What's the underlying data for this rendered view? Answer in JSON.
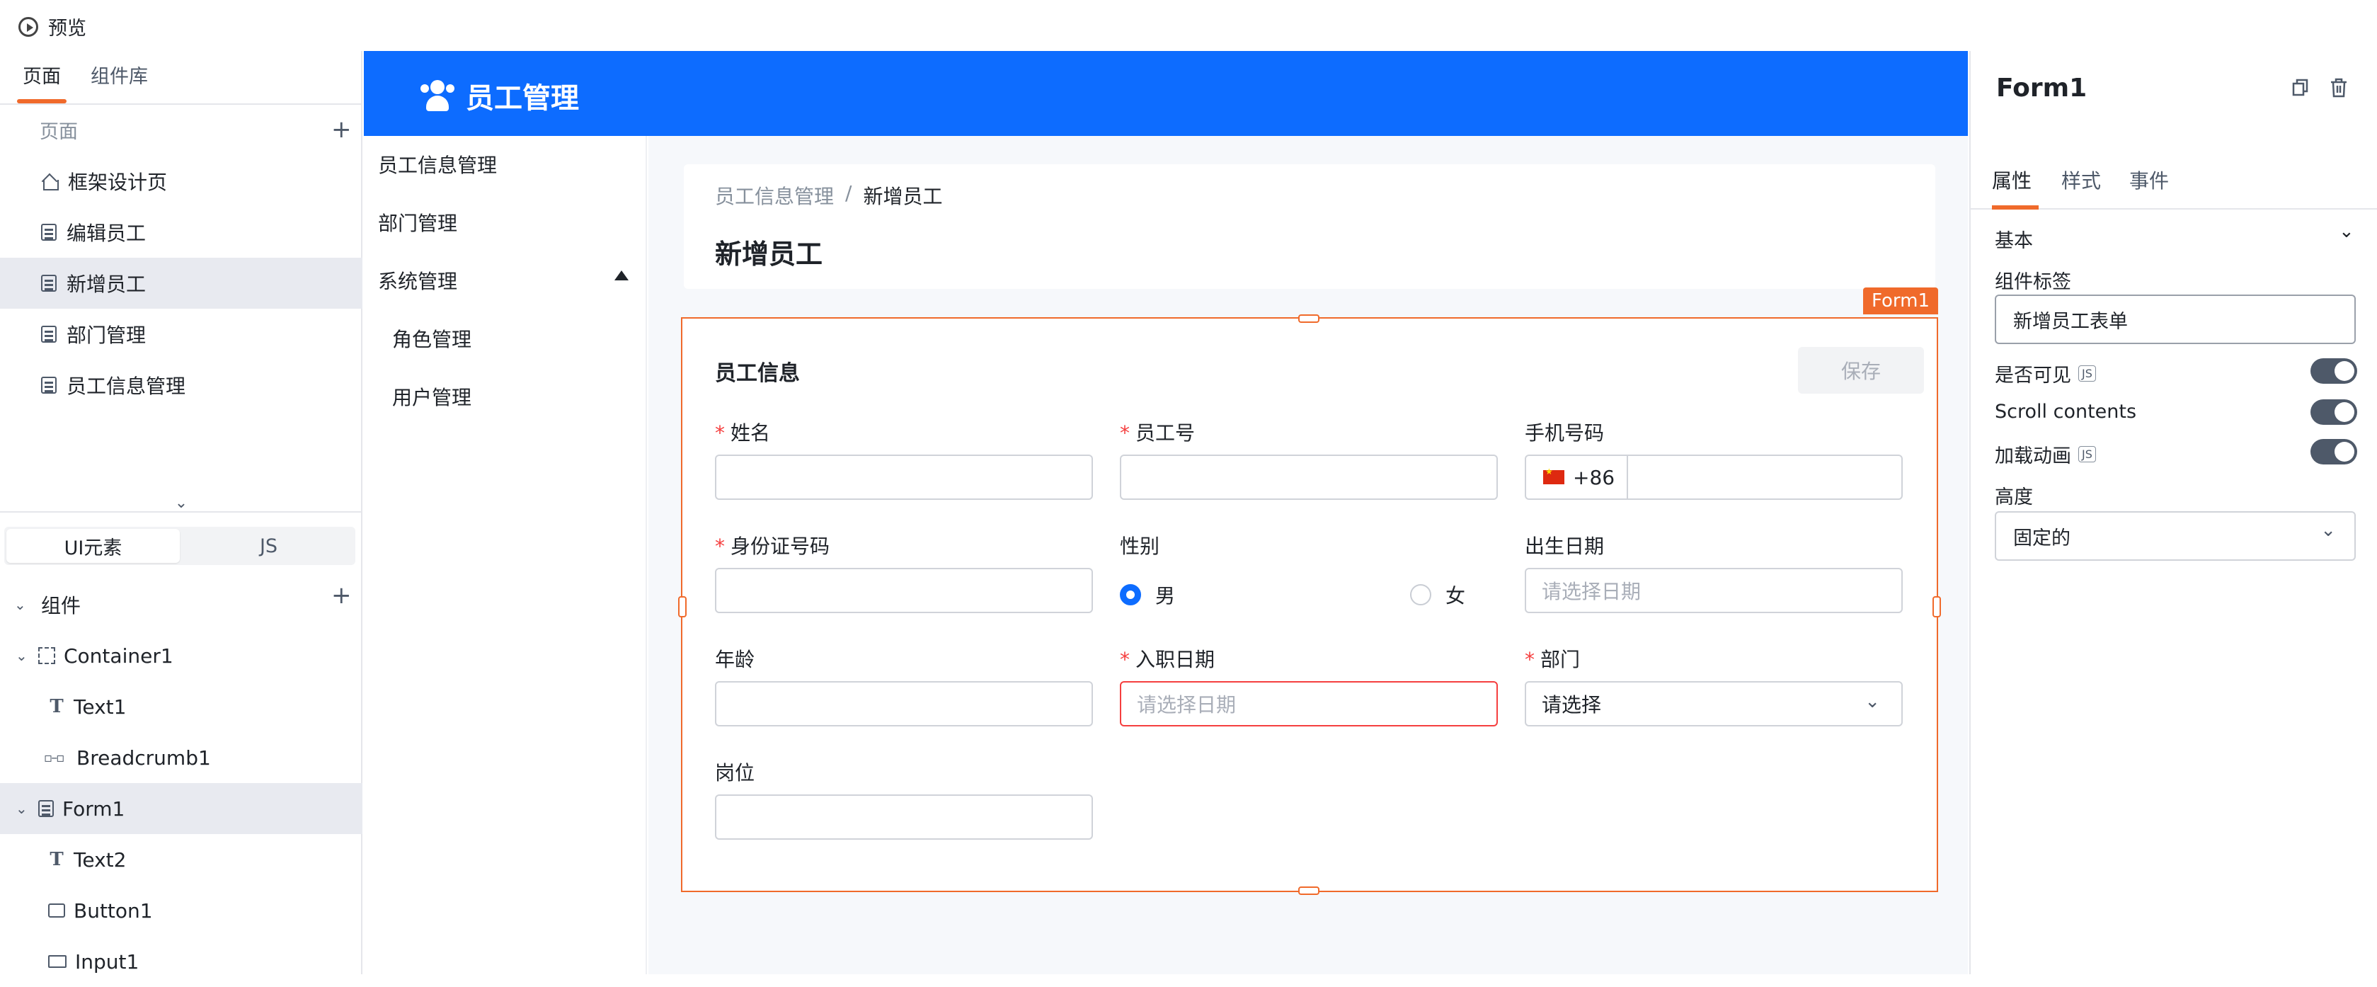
{
  "topbar": {
    "preview_label": "预览"
  },
  "left_panel": {
    "tabs": [
      "页面",
      "组件库"
    ],
    "pages_header": "页面",
    "pages": [
      {
        "label": "框架设计页",
        "icon": "home-icon",
        "selected": false
      },
      {
        "label": "编辑员工",
        "icon": "page-icon",
        "selected": false
      },
      {
        "label": "新增员工",
        "icon": "page-icon",
        "selected": true
      },
      {
        "label": "部门管理",
        "icon": "page-icon",
        "selected": false
      },
      {
        "label": "员工信息管理",
        "icon": "page-icon",
        "selected": false
      }
    ],
    "segment": [
      "UI元素",
      "JS"
    ],
    "components_header": "组件",
    "tree": [
      {
        "label": "Container1",
        "icon": "container-icon",
        "selected": false
      },
      {
        "label": "Text1",
        "icon": "text-icon",
        "selected": false
      },
      {
        "label": "Breadcrumb1",
        "icon": "breadcrumb-icon",
        "selected": false
      },
      {
        "label": "Form1",
        "icon": "form-icon",
        "selected": true
      },
      {
        "label": "Text2",
        "icon": "text-icon",
        "selected": false
      },
      {
        "label": "Button1",
        "icon": "button-icon",
        "selected": false
      },
      {
        "label": "Input1",
        "icon": "input-icon",
        "selected": false
      }
    ]
  },
  "app": {
    "title": "员工管理",
    "header_color": "#0d6cff",
    "nav": [
      "员工信息管理",
      "部门管理",
      "系统管理",
      "角色管理",
      "用户管理"
    ],
    "breadcrumb": [
      "员工信息管理",
      "/",
      "新增员工"
    ],
    "page_title": "新增员工"
  },
  "form": {
    "tag": "Form1",
    "section_title": "员工信息",
    "save_label": "保存",
    "fields": {
      "name": {
        "label": "姓名",
        "required": "*"
      },
      "emp_no": {
        "label": "员工号",
        "required": "*"
      },
      "phone": {
        "label": "手机号码",
        "prefix": "+86"
      },
      "id_no": {
        "label": "身份证号码",
        "required": "*"
      },
      "gender": {
        "label": "性别",
        "options": [
          "男",
          "女"
        ],
        "selected": "男"
      },
      "birth": {
        "label": "出生日期",
        "placeholder": "请选择日期"
      },
      "age": {
        "label": "年龄"
      },
      "hire_date": {
        "label": "入职日期",
        "required": "*",
        "placeholder": "请选择日期"
      },
      "dept": {
        "label": "部门",
        "required": "*",
        "placeholder": "请选择"
      },
      "position": {
        "label": "岗位"
      }
    },
    "accent_color": "#f06a2b"
  },
  "right_panel": {
    "title": "Form1",
    "tabs": [
      "属性",
      "样式",
      "事件"
    ],
    "section": "基本",
    "component_label": {
      "label": "组件标签",
      "value": "新增员工表单"
    },
    "visible": {
      "label": "是否可见",
      "js": "JS",
      "on": true
    },
    "scroll": {
      "label": "Scroll contents",
      "on": true
    },
    "animation": {
      "label": "加载动画",
      "js": "JS",
      "on": true
    },
    "height": {
      "label": "高度",
      "value": "固定的"
    }
  }
}
